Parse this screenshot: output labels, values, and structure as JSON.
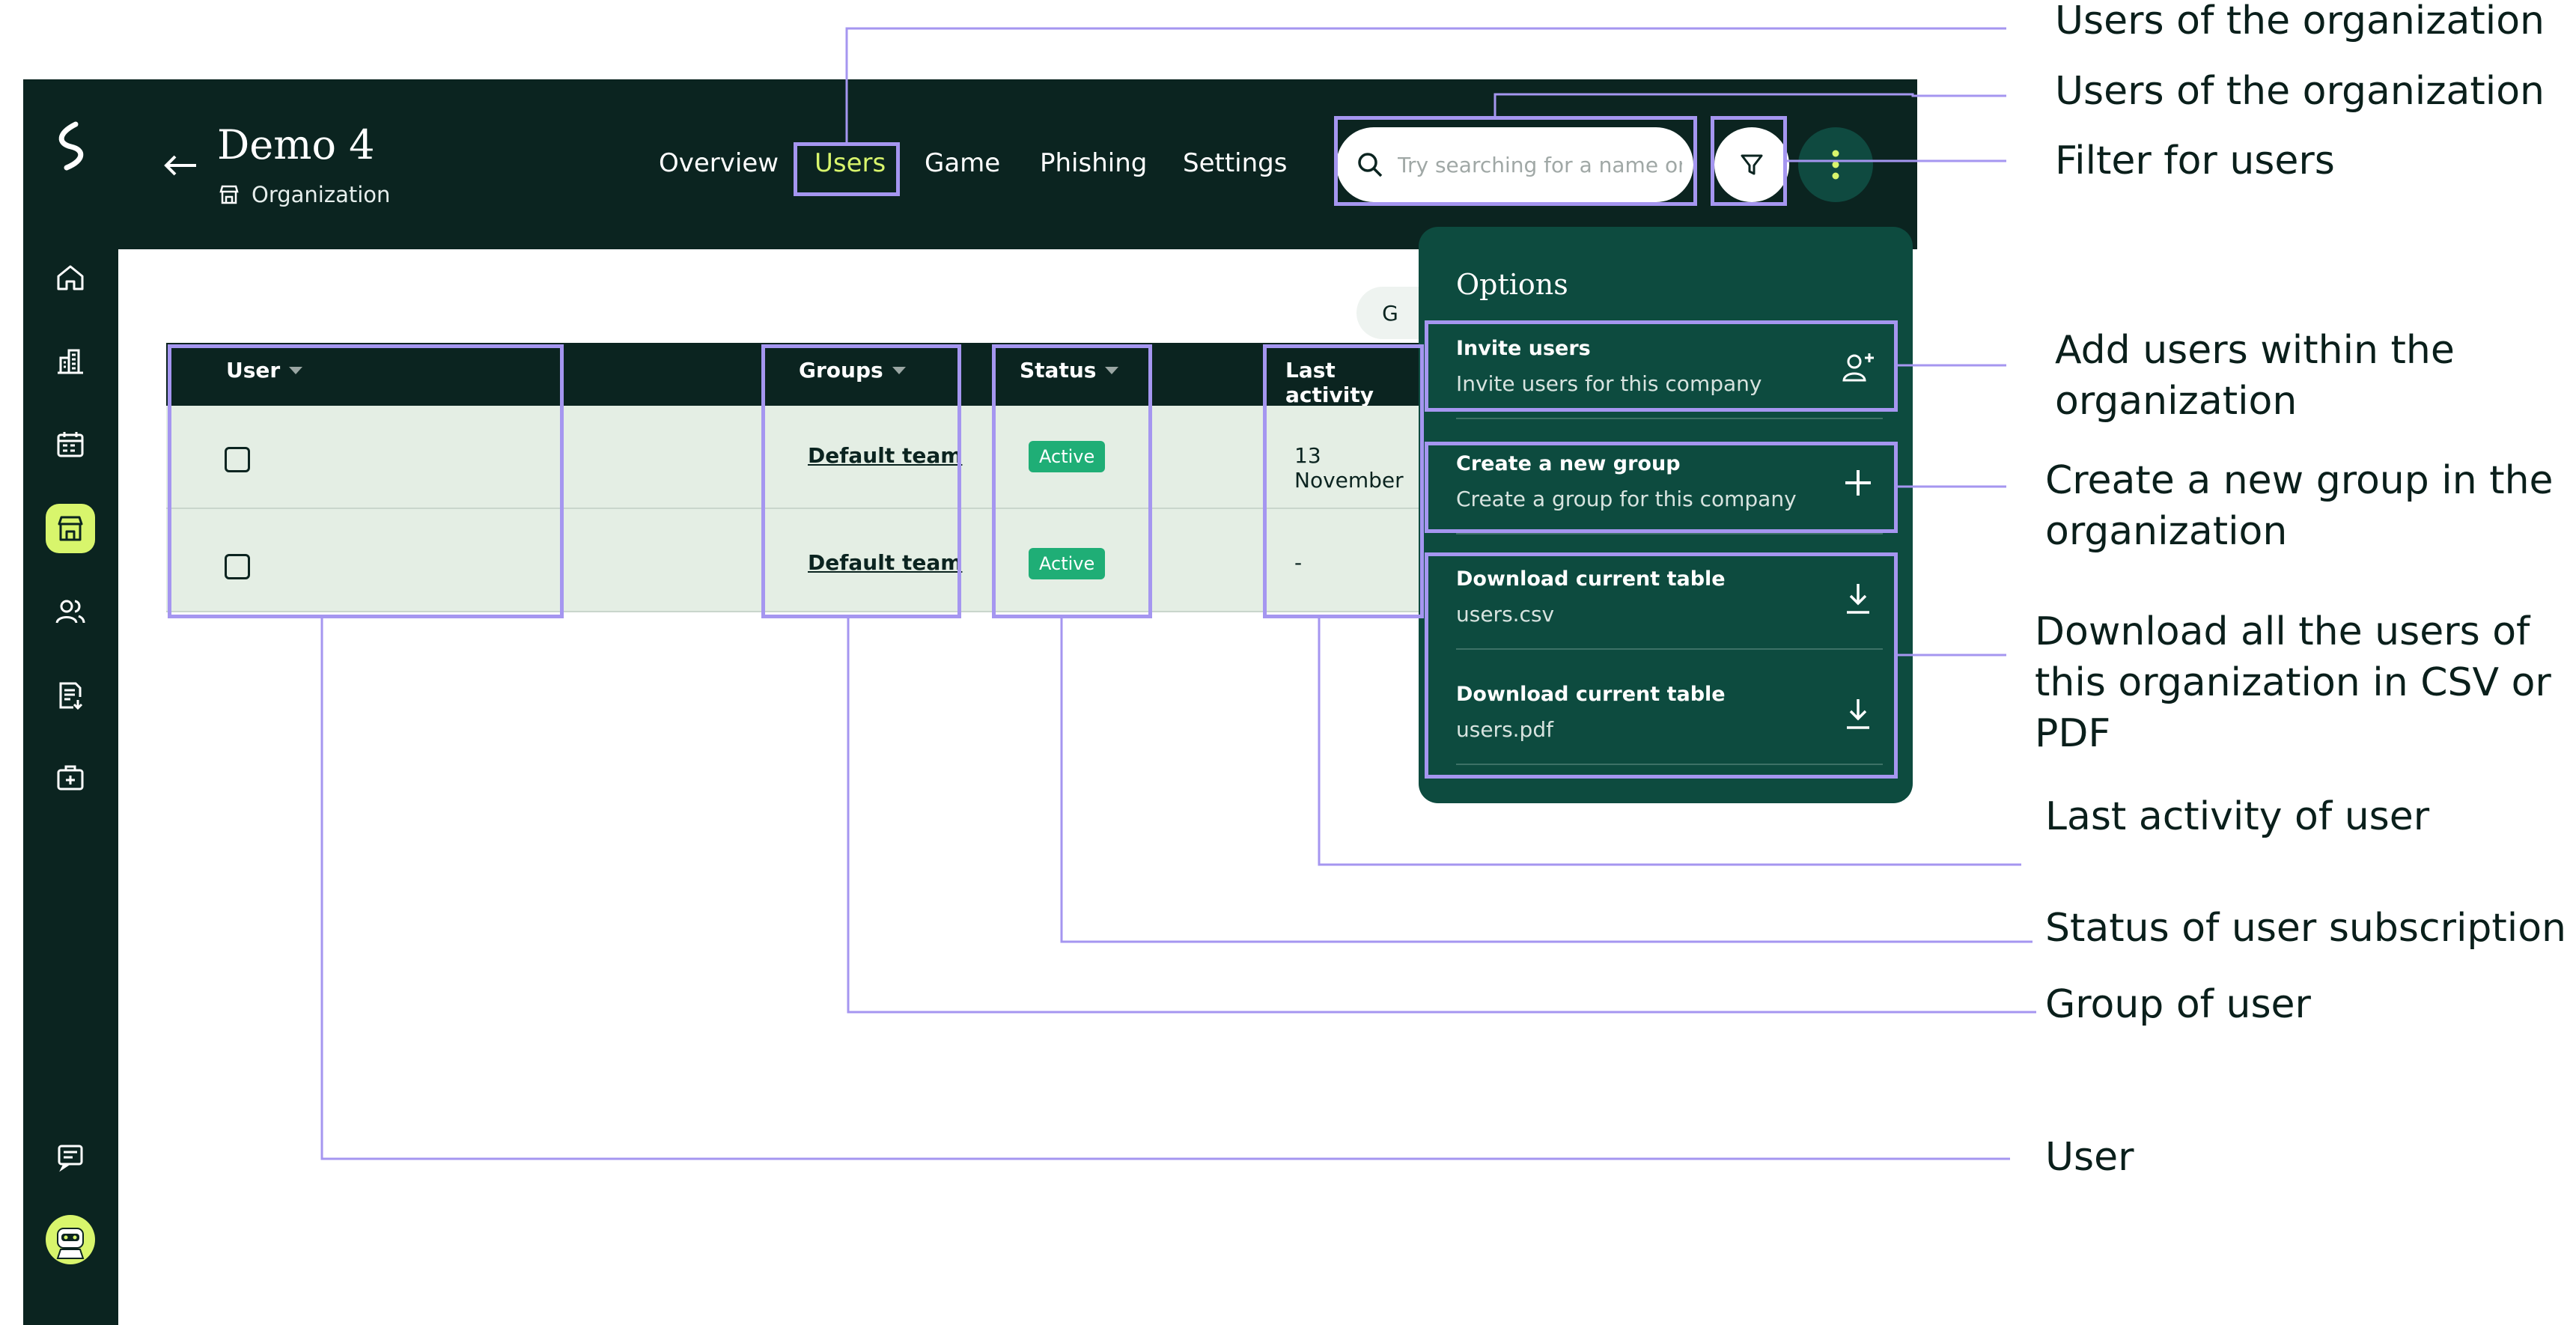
{
  "colors": {
    "dark_bg": "#0b2420",
    "accent": "#d8f56c",
    "menu_bg": "#0d4b3f",
    "row_bg": "#e4eee4",
    "badge": "#1fae76",
    "annotation": "#a596f0"
  },
  "sidebar": {
    "logo": "brand-logo-icon",
    "items": [
      {
        "icon": "home-icon"
      },
      {
        "icon": "buildings-icon"
      },
      {
        "icon": "calendar-icon"
      },
      {
        "icon": "store-icon",
        "active": true
      },
      {
        "icon": "users-icon"
      },
      {
        "icon": "report-download-icon"
      },
      {
        "icon": "medical-kit-icon"
      }
    ],
    "chat_icon": "chat-icon",
    "avatar": "robot-avatar"
  },
  "header": {
    "title": "Demo 4",
    "subtitle": "Organization",
    "back_icon": "back-arrow-icon",
    "nav": [
      {
        "label": "Overview"
      },
      {
        "label": "Users",
        "active": true
      },
      {
        "label": "Game"
      },
      {
        "label": "Phishing"
      },
      {
        "label": "Settings"
      }
    ],
    "search_placeholder": "Try searching for a name or e"
  },
  "table": {
    "pill_label": "G",
    "columns": [
      "User",
      "Groups",
      "Status",
      "Last activity"
    ],
    "rows": [
      {
        "group": "Default team",
        "status": "Active",
        "last_activity": "13 November"
      },
      {
        "group": "Default team",
        "status": "Active",
        "last_activity": "-"
      }
    ]
  },
  "options_menu": {
    "title": "Options",
    "items": [
      {
        "title": "Invite users",
        "subtitle": "Invite users for this company",
        "icon": "user-plus-icon"
      },
      {
        "title": "Create a new group",
        "subtitle": "Create a group for this company",
        "icon": "plus-icon"
      },
      {
        "title": "Download current table",
        "subtitle": "users.csv",
        "icon": "download-icon"
      },
      {
        "title": "Download current table",
        "subtitle": "users.pdf",
        "icon": "download-icon"
      }
    ]
  },
  "annotations": {
    "users_tab": "Users of the organization",
    "search": "Users of the organization",
    "filter": "Filter for users",
    "invite": "Add users within the organization",
    "create_group": "Create a new group in the organization",
    "download": "Download all the users of this organization in CSV or PDF",
    "last_activity": "Last activity of user",
    "status": "Status of user subscription",
    "group": "Group of user",
    "user": "User"
  }
}
